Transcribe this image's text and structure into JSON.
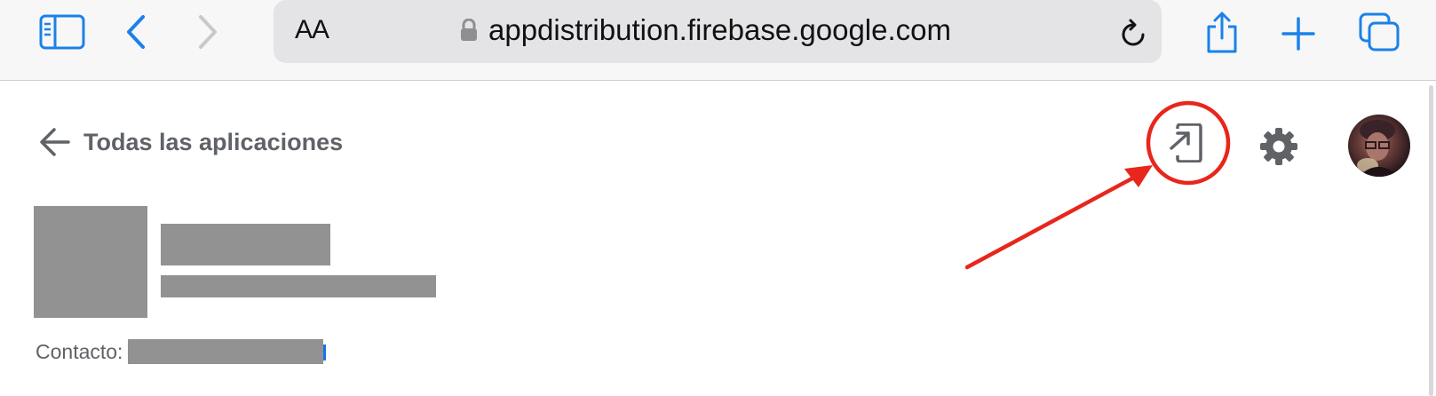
{
  "browser": {
    "text_size_label": "AA",
    "url": "appdistribution.firebase.google.com",
    "accent_color": "#1a82e8"
  },
  "page": {
    "back_label": "Todas las aplicaciones",
    "contact_label": "Contacto:",
    "icons": {
      "add_device": "phone-add-icon",
      "settings": "gear-icon",
      "avatar": "user-avatar"
    }
  },
  "annotation": {
    "color": "#e8261c"
  }
}
